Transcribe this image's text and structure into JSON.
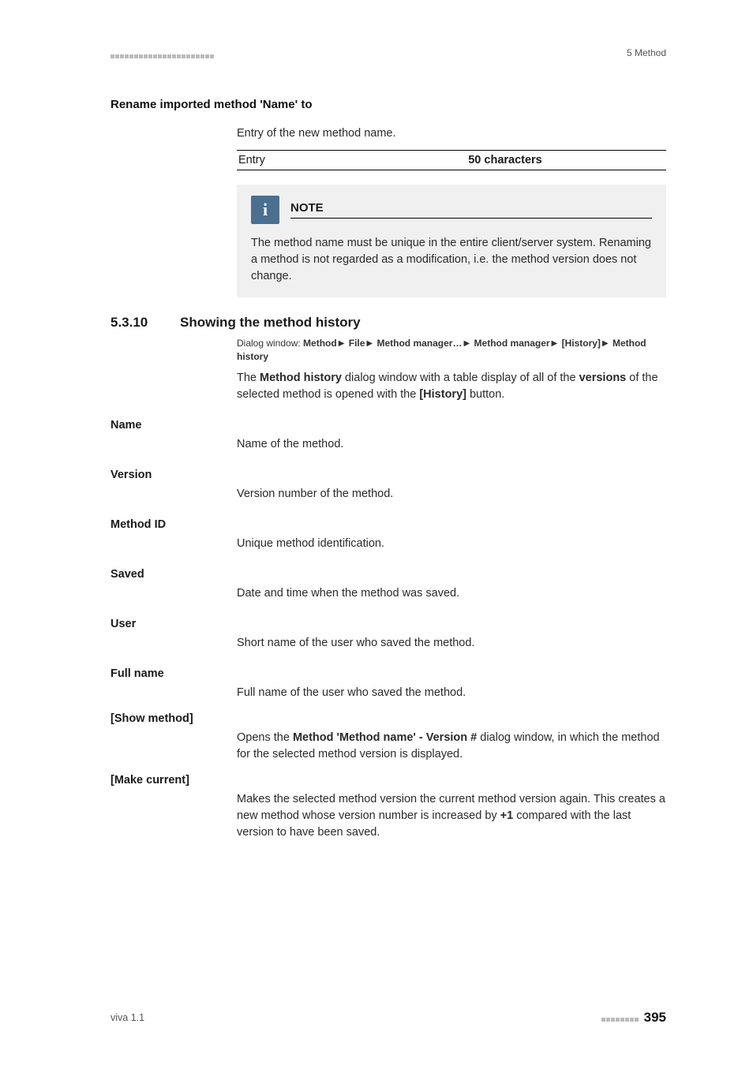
{
  "header": {
    "right": "5 Method"
  },
  "rename": {
    "heading": "Rename imported method 'Name' to",
    "desc": "Entry of the new method name.",
    "entry_label": "Entry",
    "entry_value": "50 characters"
  },
  "note": {
    "title": "NOTE",
    "body": "The method name must be unique in the entire client/server system. Renaming a method is not regarded as a modification, i.e. the method version does not change."
  },
  "section": {
    "num": "5.3.10",
    "title": "Showing the method history",
    "crumb_prefix": "Dialog window: ",
    "crumb_parts": [
      "Method",
      "File",
      "Method manager…",
      "Method manager",
      "[History]",
      "Method history"
    ],
    "intro_pre": "The ",
    "intro_b1": "Method history",
    "intro_mid1": " dialog window with a table display of all of the ",
    "intro_b2": "versions",
    "intro_mid2": " of the selected method is opened with the ",
    "intro_b3": "[History]",
    "intro_end": " button."
  },
  "defs": {
    "name": {
      "term": "Name",
      "body": "Name of the method."
    },
    "version": {
      "term": "Version",
      "body": "Version number of the method."
    },
    "method_id": {
      "term": "Method ID",
      "body": "Unique method identification."
    },
    "saved": {
      "term": "Saved",
      "body": "Date and time when the method was saved."
    },
    "user": {
      "term": "User",
      "body": "Short name of the user who saved the method."
    },
    "full_name": {
      "term": "Full name",
      "body": "Full name of the user who saved the method."
    },
    "show_method": {
      "term": "[Show method]",
      "pre": "Opens the ",
      "b": "Method 'Method name' - Version #",
      "post": " dialog window, in which the method for the selected method version is displayed."
    },
    "make_current": {
      "term": "[Make current]",
      "pre": "Makes the selected method version the current method version again. This creates a new method whose version number is increased by ",
      "b": "+1",
      "post": " compared with the last version to have been saved."
    }
  },
  "footer": {
    "left": "viva 1.1",
    "page": "395"
  }
}
